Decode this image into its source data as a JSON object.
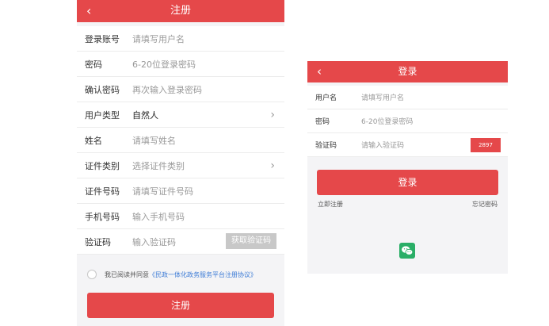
{
  "register": {
    "title": "注册",
    "back": "‹",
    "fields": [
      {
        "label": "登录账号",
        "placeholder": "请填写用户名"
      },
      {
        "label": "密码",
        "placeholder": "6-20位登录密码"
      },
      {
        "label": "确认密码",
        "placeholder": "再次输入登录密码"
      },
      {
        "label": "用户类型",
        "value": "自然人"
      },
      {
        "label": "姓名",
        "placeholder": "请填写姓名"
      },
      {
        "label": "证件类别",
        "placeholder": "选择证件类别"
      },
      {
        "label": "证件号码",
        "placeholder": "请填写证件号码"
      },
      {
        "label": "手机号码",
        "placeholder": "输入手机号码"
      },
      {
        "label": "验证码",
        "placeholder": "输入验证码"
      }
    ],
    "get_code_label": "获取验证码",
    "agree_prefix": "我已阅读并同意",
    "agree_link": "《民政一体化政务服务平台注册协议》",
    "submit_label": "注册"
  },
  "login": {
    "title": "登录",
    "back": "‹",
    "fields": [
      {
        "label": "用户名",
        "placeholder": "请填写用户名"
      },
      {
        "label": "密码",
        "placeholder": "6-20位登录密码"
      },
      {
        "label": "验证码",
        "placeholder": "请输入验证码"
      }
    ],
    "captcha": "2897",
    "submit_label": "登录",
    "register_link": "立即注册",
    "forgot_link": "忘记密码"
  },
  "icons": {
    "chevron": "chevron-right-icon",
    "wechat": "wechat-icon"
  },
  "colors": {
    "accent": "#e5484a",
    "link": "#3c7bd6",
    "wechat": "#2aae67"
  }
}
